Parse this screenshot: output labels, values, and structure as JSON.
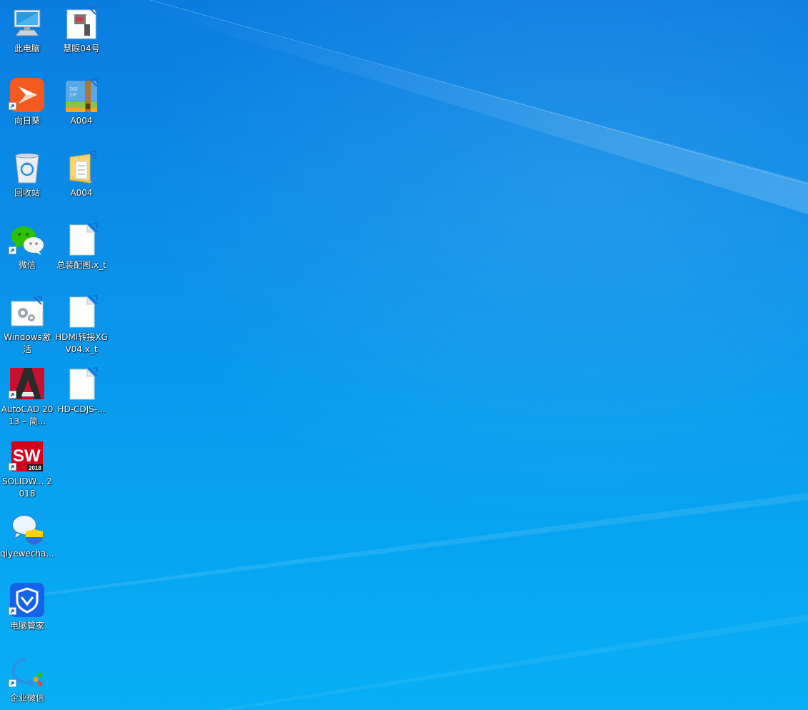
{
  "desktop": {
    "wallpaper": "Windows 10 default blue",
    "colors": {
      "top": "#0a7ce0",
      "bottom": "#08aff5"
    },
    "icons": {
      "this_pc": {
        "label": "此电脑",
        "icon": "computer-icon"
      },
      "huiyan": {
        "label": "慧眼04号",
        "icon": "cad-file-icon"
      },
      "sunlogin": {
        "label": "向日葵",
        "icon": "sunlogin-icon",
        "shortcut": true
      },
      "a004_zip": {
        "label": "A004",
        "icon": "zip-archive-icon"
      },
      "recycle_bin": {
        "label": "回收站",
        "icon": "recycle-bin-icon"
      },
      "a004_folder": {
        "label": "A004",
        "icon": "folder-icon"
      },
      "wechat": {
        "label": "微信",
        "icon": "wechat-icon",
        "shortcut": true
      },
      "assembly_xt": {
        "label": "总装配图.x_t",
        "icon": "blank-file-icon"
      },
      "windows_activate": {
        "label": "Windows激活",
        "icon": "settings-window-icon"
      },
      "hdmi_xt": {
        "label": "HDMI转接XGV04.x_t",
        "icon": "blank-file-icon"
      },
      "autocad": {
        "label": "AutoCAD 2013 – 简...",
        "icon": "autocad-icon",
        "shortcut": true
      },
      "hd_cdjs": {
        "label": "HD-CDJS-...",
        "icon": "blank-file-icon"
      },
      "solidworks": {
        "label": "SOLIDW... 2018",
        "icon": "solidworks-icon",
        "shortcut": true,
        "badge": "2018"
      },
      "qiyewechat_installer": {
        "label": "qiyewecha...",
        "icon": "installer-chat-icon"
      },
      "pc_manager": {
        "label": "电脑管家",
        "icon": "shield-icon",
        "shortcut": true
      },
      "wecom": {
        "label": "企业微信",
        "icon": "wecom-icon",
        "shortcut": true
      }
    }
  }
}
